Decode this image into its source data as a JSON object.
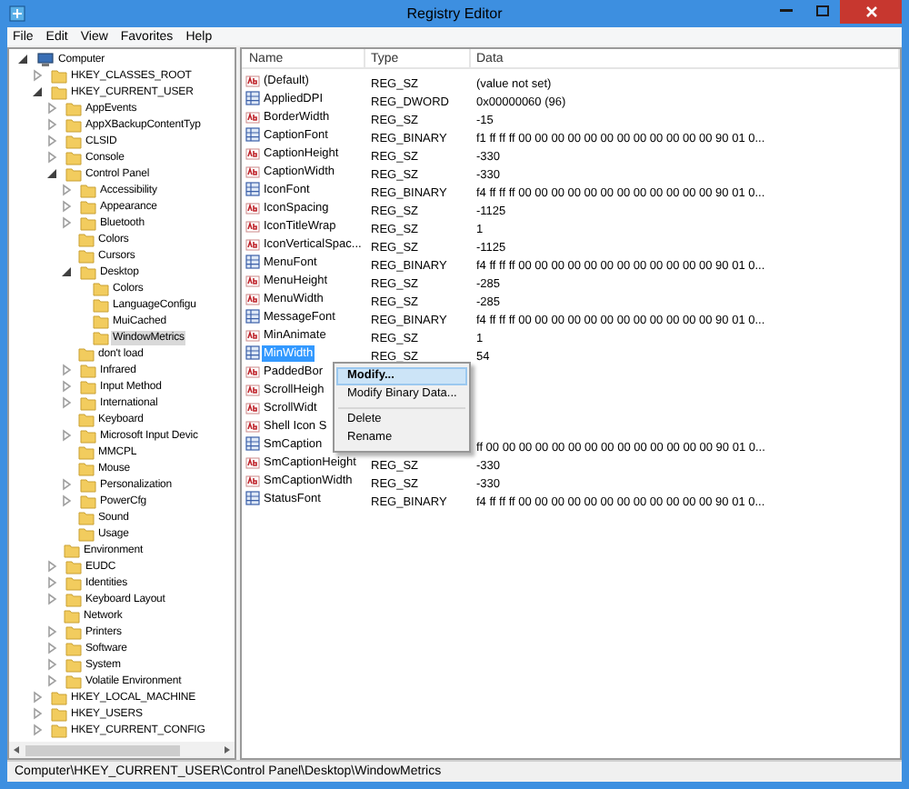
{
  "window": {
    "title": "Registry Editor"
  },
  "menu": [
    "File",
    "Edit",
    "View",
    "Favorites",
    "Help"
  ],
  "tree": [
    {
      "label": "Computer",
      "kind": "computer",
      "expanded": true,
      "selected": false,
      "children": [
        {
          "label": "HKEY_CLASSES_ROOT",
          "kind": "branch",
          "expanded": false,
          "selected": false
        },
        {
          "label": "HKEY_CURRENT_USER",
          "kind": "branch",
          "expanded": true,
          "selected": false,
          "children": [
            {
              "label": "AppEvents",
              "kind": "branch",
              "expanded": false,
              "selected": false
            },
            {
              "label": "AppXBackupContentTyp",
              "kind": "branch",
              "expanded": false,
              "selected": false
            },
            {
              "label": "CLSID",
              "kind": "branch",
              "expanded": false,
              "selected": false
            },
            {
              "label": "Console",
              "kind": "branch",
              "expanded": false,
              "selected": false
            },
            {
              "label": "Control Panel",
              "kind": "branch",
              "expanded": true,
              "selected": false,
              "children": [
                {
                  "label": "Accessibility",
                  "kind": "branch",
                  "expanded": false,
                  "selected": false
                },
                {
                  "label": "Appearance",
                  "kind": "branch",
                  "expanded": false,
                  "selected": false
                },
                {
                  "label": "Bluetooth",
                  "kind": "branch",
                  "expanded": false,
                  "selected": false
                },
                {
                  "label": "Colors",
                  "kind": "leaf",
                  "selected": false
                },
                {
                  "label": "Cursors",
                  "kind": "leaf",
                  "selected": false
                },
                {
                  "label": "Desktop",
                  "kind": "branch",
                  "expanded": true,
                  "selected": false,
                  "children": [
                    {
                      "label": "Colors",
                      "kind": "leaf",
                      "selected": false
                    },
                    {
                      "label": "LanguageConfigu",
                      "kind": "leaf",
                      "selected": false
                    },
                    {
                      "label": "MuiCached",
                      "kind": "leaf",
                      "selected": false
                    },
                    {
                      "label": "WindowMetrics",
                      "kind": "leaf",
                      "selected": true
                    }
                  ]
                },
                {
                  "label": "don't load",
                  "kind": "leaf",
                  "selected": false
                },
                {
                  "label": "Infrared",
                  "kind": "branch",
                  "expanded": false,
                  "selected": false
                },
                {
                  "label": "Input Method",
                  "kind": "branch",
                  "expanded": false,
                  "selected": false
                },
                {
                  "label": "International",
                  "kind": "branch",
                  "expanded": false,
                  "selected": false
                },
                {
                  "label": "Keyboard",
                  "kind": "leaf",
                  "selected": false
                },
                {
                  "label": "Microsoft Input Devic",
                  "kind": "branch",
                  "expanded": false,
                  "selected": false
                },
                {
                  "label": "MMCPL",
                  "kind": "leaf",
                  "selected": false
                },
                {
                  "label": "Mouse",
                  "kind": "leaf",
                  "selected": false
                },
                {
                  "label": "Personalization",
                  "kind": "branch",
                  "expanded": false,
                  "selected": false
                },
                {
                  "label": "PowerCfg",
                  "kind": "branch",
                  "expanded": false,
                  "selected": false
                },
                {
                  "label": "Sound",
                  "kind": "leaf",
                  "selected": false
                },
                {
                  "label": "Usage",
                  "kind": "leaf",
                  "selected": false
                }
              ]
            },
            {
              "label": "Environment",
              "kind": "leaf",
              "selected": false
            },
            {
              "label": "EUDC",
              "kind": "branch",
              "expanded": false,
              "selected": false
            },
            {
              "label": "Identities",
              "kind": "branch",
              "expanded": false,
              "selected": false
            },
            {
              "label": "Keyboard Layout",
              "kind": "branch",
              "expanded": false,
              "selected": false
            },
            {
              "label": "Network",
              "kind": "leaf",
              "selected": false
            },
            {
              "label": "Printers",
              "kind": "branch",
              "expanded": false,
              "selected": false
            },
            {
              "label": "Software",
              "kind": "branch",
              "expanded": false,
              "selected": false
            },
            {
              "label": "System",
              "kind": "branch",
              "expanded": false,
              "selected": false
            },
            {
              "label": "Volatile Environment",
              "kind": "branch",
              "expanded": false,
              "selected": false
            }
          ]
        },
        {
          "label": "HKEY_LOCAL_MACHINE",
          "kind": "branch",
          "expanded": false,
          "selected": false
        },
        {
          "label": "HKEY_USERS",
          "kind": "branch",
          "expanded": false,
          "selected": false
        },
        {
          "label": "HKEY_CURRENT_CONFIG",
          "kind": "branch",
          "expanded": false,
          "selected": false
        }
      ]
    }
  ],
  "table": {
    "columns": [
      "Name",
      "Type",
      "Data"
    ],
    "rows": [
      {
        "name": "(Default)",
        "kind": "string",
        "type": "REG_SZ",
        "data": "(value not set)",
        "selected": false
      },
      {
        "name": "AppliedDPI",
        "kind": "binary",
        "type": "REG_DWORD",
        "data": "0x00000060 (96)",
        "selected": false
      },
      {
        "name": "BorderWidth",
        "kind": "string",
        "type": "REG_SZ",
        "data": "-15",
        "selected": false
      },
      {
        "name": "CaptionFont",
        "kind": "binary",
        "type": "REG_BINARY",
        "data": "f1 ff ff ff 00 00 00 00 00 00 00 00 00 00 00 00 90 01 0...",
        "selected": false
      },
      {
        "name": "CaptionHeight",
        "kind": "string",
        "type": "REG_SZ",
        "data": "-330",
        "selected": false
      },
      {
        "name": "CaptionWidth",
        "kind": "string",
        "type": "REG_SZ",
        "data": "-330",
        "selected": false
      },
      {
        "name": "IconFont",
        "kind": "binary",
        "type": "REG_BINARY",
        "data": "f4 ff ff ff 00 00 00 00 00 00 00 00 00 00 00 00 90 01 0...",
        "selected": false
      },
      {
        "name": "IconSpacing",
        "kind": "string",
        "type": "REG_SZ",
        "data": "-1125",
        "selected": false
      },
      {
        "name": "IconTitleWrap",
        "kind": "string",
        "type": "REG_SZ",
        "data": "1",
        "selected": false
      },
      {
        "name": "IconVerticalSpac...",
        "kind": "string",
        "type": "REG_SZ",
        "data": "-1125",
        "selected": false
      },
      {
        "name": "MenuFont",
        "kind": "binary",
        "type": "REG_BINARY",
        "data": "f4 ff ff ff 00 00 00 00 00 00 00 00 00 00 00 00 90 01 0...",
        "selected": false
      },
      {
        "name": "MenuHeight",
        "kind": "string",
        "type": "REG_SZ",
        "data": "-285",
        "selected": false
      },
      {
        "name": "MenuWidth",
        "kind": "string",
        "type": "REG_SZ",
        "data": "-285",
        "selected": false
      },
      {
        "name": "MessageFont",
        "kind": "binary",
        "type": "REG_BINARY",
        "data": "f4 ff ff ff 00 00 00 00 00 00 00 00 00 00 00 00 90 01 0...",
        "selected": false
      },
      {
        "name": "MinAnimate",
        "kind": "string",
        "type": "REG_SZ",
        "data": "1",
        "selected": false
      },
      {
        "name": "MinWidth",
        "kind": "binary",
        "type": "REG_SZ",
        "data": "54",
        "selected": true
      },
      {
        "name": "PaddedBor",
        "kind": "string",
        "selected": false
      },
      {
        "name": "ScrollHeigh",
        "kind": "string",
        "selected": false
      },
      {
        "name": "ScrollWidt",
        "kind": "string",
        "selected": false
      },
      {
        "name": "Shell Icon S",
        "kind": "string",
        "selected": false
      },
      {
        "name": "SmCaption",
        "kind": "binary",
        "data": "ff 00 00 00 00 00 00 00 00 00 00 00 00 00 00 90 01 0...",
        "selected": false
      },
      {
        "name": "SmCaptionHeight",
        "kind": "string",
        "type": "REG_SZ",
        "data": "-330",
        "selected": false
      },
      {
        "name": "SmCaptionWidth",
        "kind": "string",
        "type": "REG_SZ",
        "data": "-330",
        "selected": false
      },
      {
        "name": "StatusFont",
        "kind": "binary",
        "type": "REG_BINARY",
        "data": "f4 ff ff ff 00 00 00 00 00 00 00 00 00 00 00 00 90 01 0...",
        "selected": false
      }
    ]
  },
  "context_menu": [
    {
      "label": "Modify...",
      "kind": "item",
      "highlighted": true
    },
    {
      "label": "Modify Binary Data...",
      "kind": "item",
      "highlighted": false
    },
    {
      "kind": "separator"
    },
    {
      "label": "Delete",
      "kind": "item",
      "highlighted": false
    },
    {
      "label": "Rename",
      "kind": "item",
      "highlighted": false
    }
  ],
  "status_bar": "Computer\\HKEY_CURRENT_USER\\Control Panel\\Desktop\\WindowMetrics"
}
